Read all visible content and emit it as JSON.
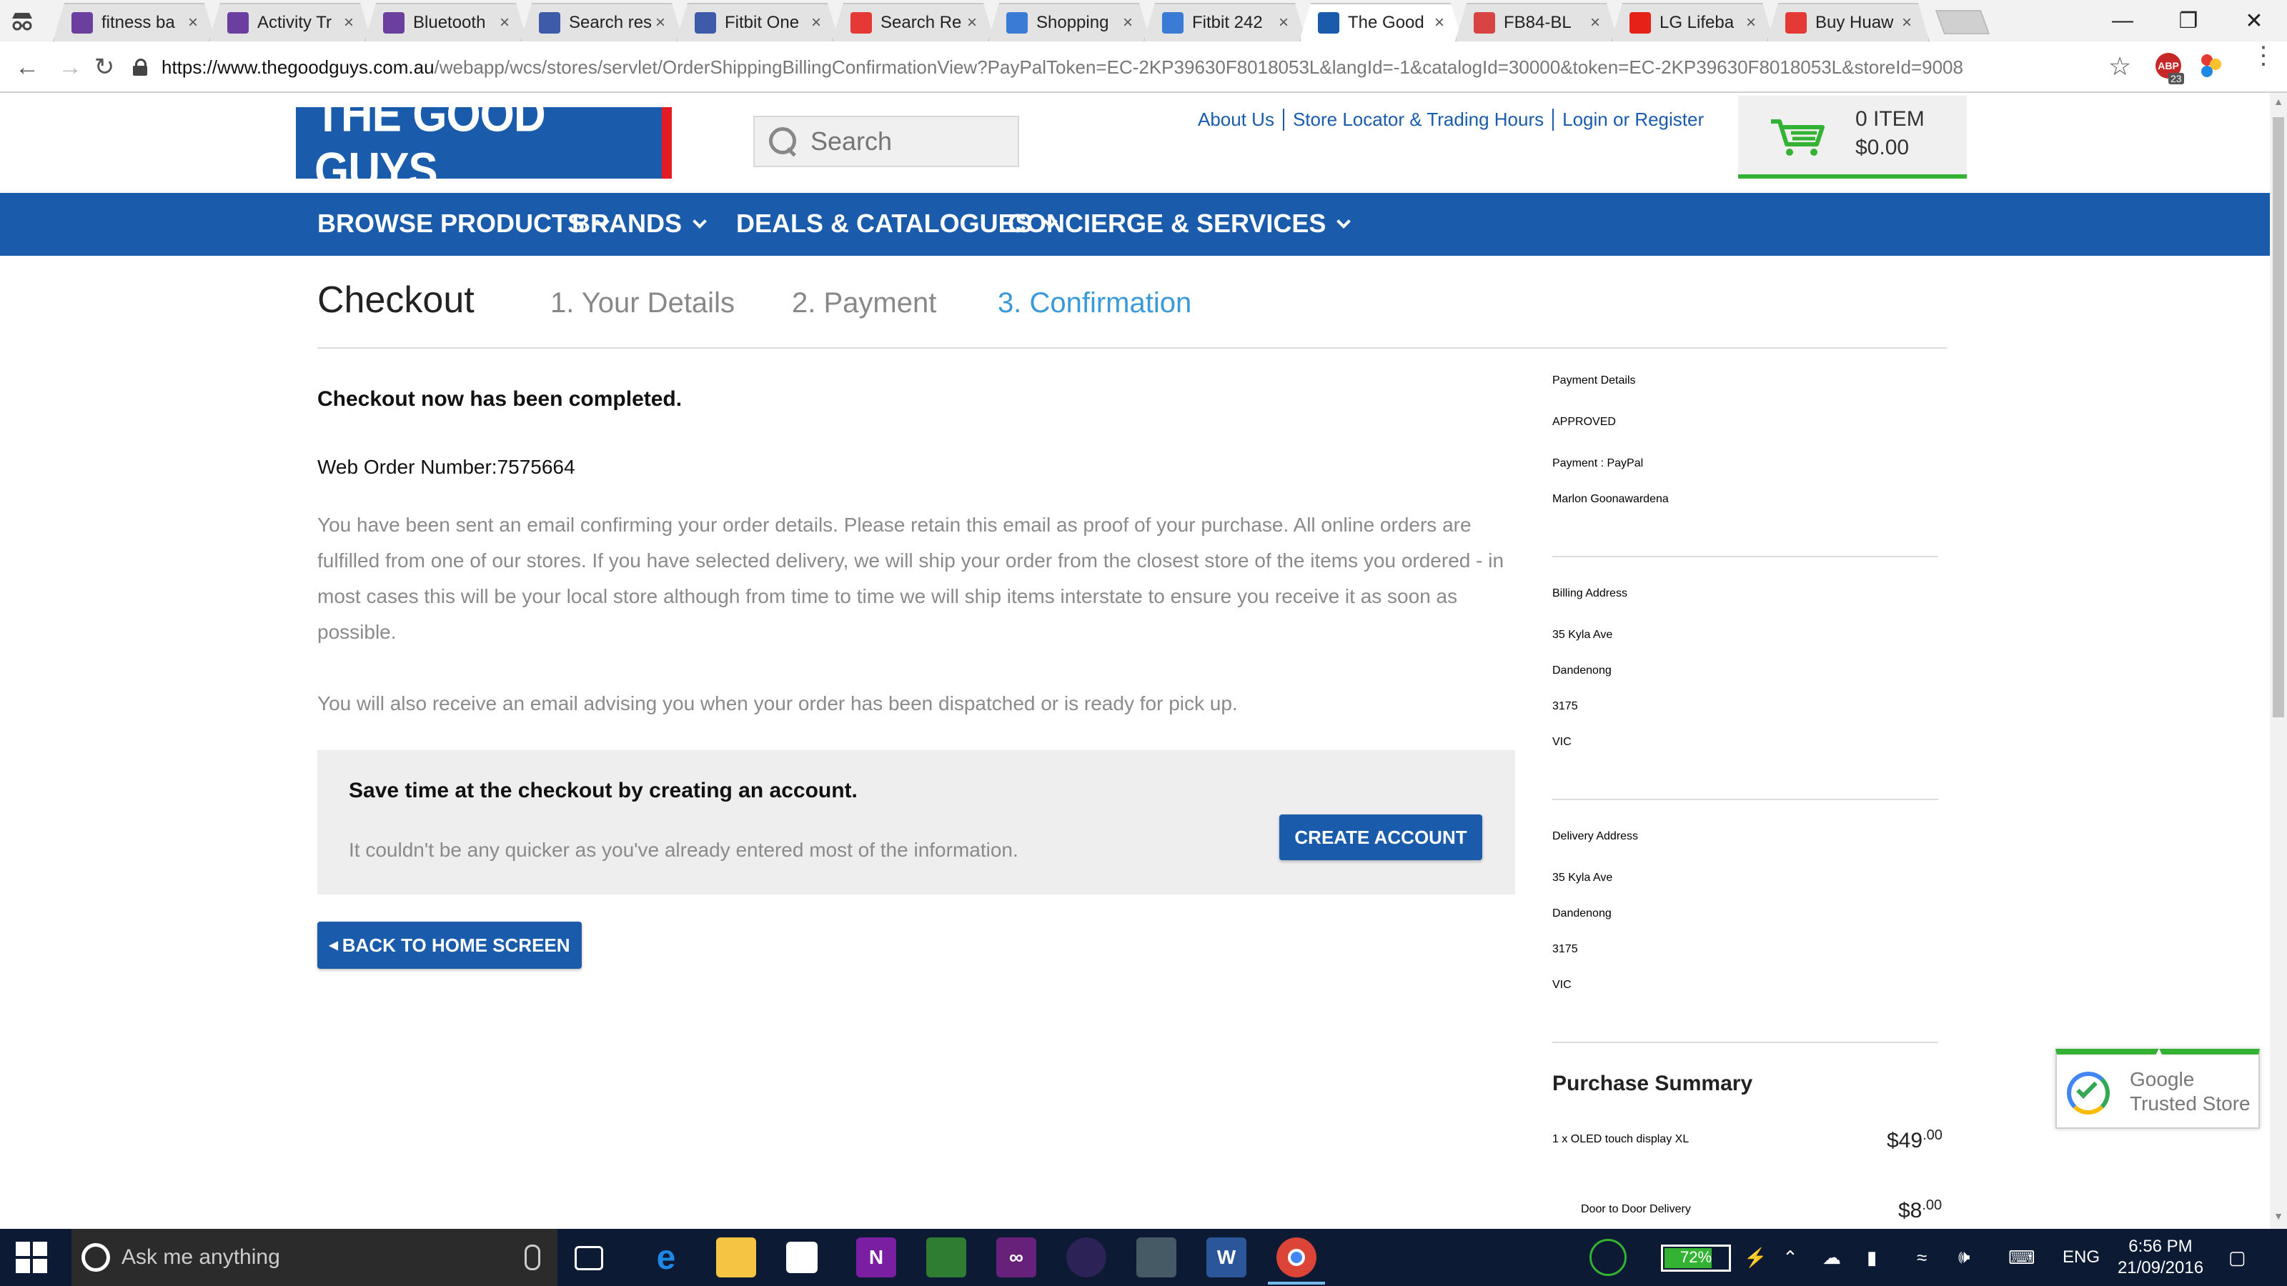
{
  "browser": {
    "tabs": [
      {
        "title": "fitness ba",
        "favicon_color": "#6b3fa0",
        "active": false
      },
      {
        "title": "Activity Tr",
        "favicon_color": "#6b3fa0",
        "active": false
      },
      {
        "title": "Bluetooth",
        "favicon_color": "#6b3fa0",
        "active": false
      },
      {
        "title": "Search res",
        "favicon_color": "#3e5ba9",
        "active": false
      },
      {
        "title": "Fitbit One",
        "favicon_color": "#3e5ba9",
        "active": false
      },
      {
        "title": "Search Re",
        "favicon_color": "#e53935",
        "active": false
      },
      {
        "title": "Shopping",
        "favicon_color": "#3a7bd5",
        "active": false
      },
      {
        "title": "Fitbit 242",
        "favicon_color": "#3a7bd5",
        "active": false
      },
      {
        "title": "The Good",
        "favicon_color": "#1a5cab",
        "active": true
      },
      {
        "title": "FB84-BL",
        "favicon_color": "#d84343",
        "active": false
      },
      {
        "title": "LG Lifeba",
        "favicon_color": "#e62117",
        "active": false
      },
      {
        "title": "Buy Huaw",
        "favicon_color": "#e53935",
        "active": false
      }
    ],
    "tab_close_glyph": "×",
    "url_host": "https://www.thegoodguys.com.au",
    "url_path": "/webapp/wcs/stores/servlet/OrderShippingBillingConfirmationView?PayPalToken=EC-2KP39630F8018053L&langId=-1&catalogId=30000&token=EC-2KP39630F8018053L&storeId=9008",
    "extension_badge": "ABP",
    "extension_count": "23",
    "icons": [
      "incognito-icon",
      "back-icon",
      "forward-icon",
      "reload-icon",
      "lock-icon",
      "star-icon",
      "menu-icon",
      "minimize-icon",
      "restore-icon",
      "close-icon"
    ]
  },
  "site": {
    "logo_text": "THE GOOD GUYS",
    "search_placeholder": "Search",
    "toplinks": [
      "About Us",
      "Store Locator & Trading Hours",
      "Login or Register"
    ],
    "cart": {
      "count": "0 ITEM",
      "total": "$0.00"
    },
    "nav": [
      "BROWSE PRODUCTS",
      "BRANDS",
      "DEALS & CATALOGUES",
      "CONCIERGE & SERVICES"
    ],
    "brand_color": "#1a5cab",
    "accent_color": "#34b233"
  },
  "checkout": {
    "title": "Checkout",
    "steps": [
      "1. Your Details",
      "2. Payment",
      "3. Confirmation"
    ],
    "active_step": 3,
    "completed_heading": "Checkout now has been completed.",
    "order_number": "Web Order Number:7575664",
    "paragraph1": "You have been sent an email confirming your order details. Please retain this email as proof of your purchase. All online orders are fulfilled from one of our stores. If you have selected delivery, we will ship your order from the closest store of the items you ordered - in most cases this will be your local store although from time to time we will ship items interstate to ensure you receive it as soon as possible.",
    "paragraph2": "You will also receive an email advising you when your order has been dispatched or is ready for pick up.",
    "account_heading": "Save time at the checkout by creating an account.",
    "account_sub": "It couldn't be any quicker as you've already entered most of the information.",
    "create_account_label": "CREATE ACCOUNT",
    "back_label": "BACK TO HOME SCREEN"
  },
  "sidebar": {
    "payment": {
      "title": "Payment Details",
      "status": "APPROVED",
      "method": "Payment : PayPal",
      "name": "Marlon Goonawardena"
    },
    "billing": {
      "title": "Billing Address",
      "lines": [
        "35 Kyla Ave",
        "Dandenong",
        "3175",
        "VIC"
      ]
    },
    "delivery": {
      "title": "Delivery Address",
      "lines": [
        "35 Kyla Ave",
        "Dandenong",
        "3175",
        "VIC"
      ]
    },
    "summary": {
      "title": "Purchase Summary",
      "items": [
        {
          "label": "1 x OLED touch display XL",
          "dollars": "$49",
          "cents": ".00"
        },
        {
          "label": "Door to Door Delivery",
          "dollars": "$8",
          "cents": ".00"
        }
      ]
    },
    "trust_badge": [
      "Google",
      "Trusted Store"
    ]
  },
  "taskbar": {
    "search_placeholder": "Ask me anything",
    "battery": "72%",
    "battery_level": 0.72,
    "language": "ENG",
    "time": "6:56 PM",
    "date": "21/09/2016",
    "pinned": [
      "task-view-icon",
      "edge-icon",
      "file-explorer-icon",
      "store-icon",
      "onenote-icon",
      "app-icon",
      "visual-studio-icon",
      "eclipse-icon",
      "network-app-icon",
      "word-icon",
      "chrome-icon"
    ]
  }
}
